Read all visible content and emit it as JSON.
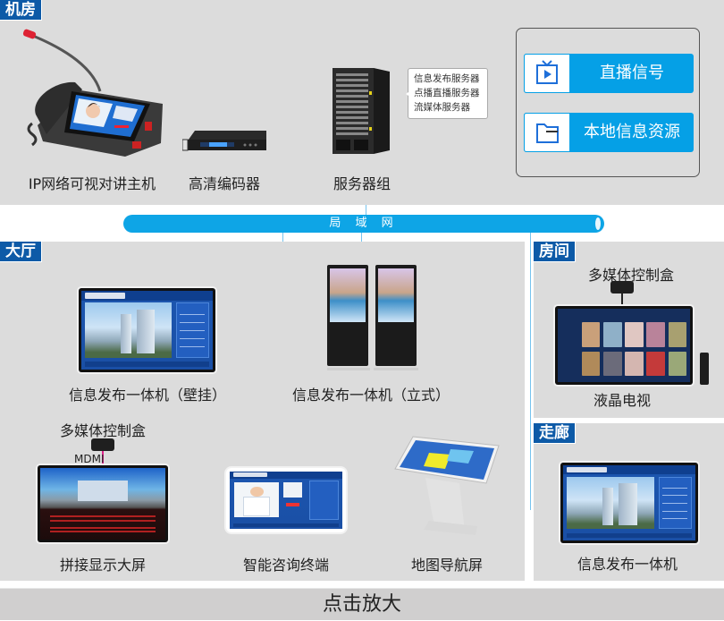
{
  "sections": {
    "machine_room": {
      "tag": "机房"
    },
    "hall": {
      "tag": "大厅"
    },
    "room": {
      "tag": "房间"
    },
    "corridor": {
      "tag": "走廊"
    }
  },
  "machine_room": {
    "devices": [
      {
        "label": "IP网络可视对讲主机",
        "icon": "video-intercom-icon"
      },
      {
        "label": "高清编码器",
        "icon": "encoder-icon"
      },
      {
        "label": "服务器组",
        "icon": "server-rack-icon"
      }
    ],
    "server_tooltip": [
      "信息发布服务器",
      "点播直播服务器",
      "流媒体服务器"
    ],
    "sources": [
      {
        "label": "直播信号",
        "icon": "tv-play-icon"
      },
      {
        "label": "本地信息资源",
        "icon": "folder-icon"
      }
    ],
    "source_colors": {
      "button": "#05a0e6",
      "icon": "#1e6fd9"
    }
  },
  "network": {
    "label": "局 域 网",
    "color": "#0ea5e6"
  },
  "hall": {
    "devices": [
      {
        "label": "信息发布一体机（壁挂）",
        "icon": "wall-display-icon"
      },
      {
        "label": "信息发布一体机（立式）",
        "icon": "standing-kiosk-icon"
      },
      {
        "label": "拼接显示大屏",
        "icon": "video-wall-icon"
      },
      {
        "label": "智能咨询终端",
        "icon": "consult-terminal-icon"
      },
      {
        "label": "地图导航屏",
        "icon": "map-kiosk-icon"
      }
    ],
    "control_box_label": "多媒体控制盒",
    "cable_label": "MDMI"
  },
  "room": {
    "control_box_label": "多媒体控制盒",
    "tv_label": "液晶电视"
  },
  "corridor": {
    "device_label": "信息发布一体机"
  },
  "footer": {
    "label": "点击放大"
  },
  "colors": {
    "tag_bg": "#0d5aa7",
    "panel_bg": "#dcdcdc",
    "footer_bg": "#d0cfcf",
    "cable": "#e0218a"
  }
}
